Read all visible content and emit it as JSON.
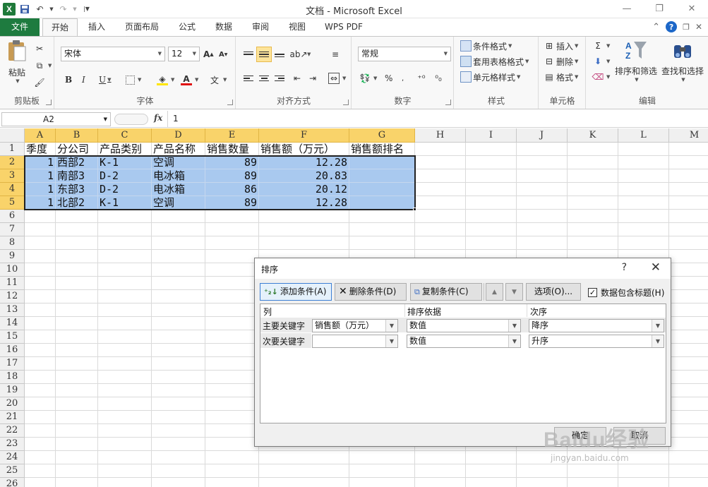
{
  "window": {
    "title": "文档 - Microsoft Excel"
  },
  "tabs": [
    {
      "label": "文件"
    },
    {
      "label": "开始"
    },
    {
      "label": "插入"
    },
    {
      "label": "页面布局"
    },
    {
      "label": "公式"
    },
    {
      "label": "数据"
    },
    {
      "label": "审阅"
    },
    {
      "label": "视图"
    },
    {
      "label": "WPS PDF"
    }
  ],
  "ribbon": {
    "clipboard": {
      "label": "剪贴板",
      "paste": "粘贴"
    },
    "font": {
      "label": "字体",
      "family": "宋体",
      "size": "12",
      "bold": "B",
      "italic": "I",
      "underline": "U"
    },
    "alignment": {
      "label": "对齐方式"
    },
    "number": {
      "label": "数字",
      "format": "常规",
      "percent": "%"
    },
    "styles": {
      "label": "样式",
      "conditional": "条件格式",
      "table_format": "套用表格格式",
      "cell_style": "单元格样式"
    },
    "cells": {
      "label": "单元格",
      "insert": "插入",
      "delete": "删除",
      "format": "格式"
    },
    "editing": {
      "label": "编辑",
      "sort_filter": "排序和筛选",
      "find_select": "查找和选择"
    }
  },
  "formula_bar": {
    "name_box": "A2",
    "fx": "fx",
    "value": "1"
  },
  "sheet": {
    "columns": [
      "A",
      "B",
      "C",
      "D",
      "E",
      "F",
      "G",
      "H",
      "I",
      "J",
      "K",
      "L",
      "M"
    ],
    "rows": [
      "1",
      "2",
      "3",
      "4",
      "5",
      "6",
      "7",
      "8",
      "9",
      "10",
      "11",
      "12",
      "13",
      "14",
      "15",
      "16",
      "17",
      "18",
      "19",
      "20",
      "21",
      "22",
      "23",
      "24",
      "25",
      "26"
    ],
    "header": [
      "季度",
      "分公司",
      "产品类别",
      "产品名称",
      "销售数量",
      "销售额（万元）",
      "销售额排名"
    ],
    "data": [
      [
        "1",
        "西部2",
        "K-1",
        "空调",
        "89",
        "12.28",
        ""
      ],
      [
        "1",
        "南部3",
        "D-2",
        "电冰箱",
        "89",
        "20.83",
        ""
      ],
      [
        "1",
        "东部3",
        "D-2",
        "电冰箱",
        "86",
        "20.12",
        ""
      ],
      [
        "1",
        "北部2",
        "K-1",
        "空调",
        "89",
        "12.28",
        ""
      ]
    ]
  },
  "dialog": {
    "title": "排序",
    "help": "?",
    "close": "✕",
    "add": "添加条件(A)",
    "delete": "删除条件(D)",
    "copy": "复制条件(C)",
    "options": "选项(O)...",
    "has_header": "数据包含标题(H)",
    "col_header": "列",
    "sort_on_header": "排序依据",
    "order_header": "次序",
    "rows": [
      {
        "label": "主要关键字",
        "column": "销售额（万元）",
        "sort_on": "数值",
        "order": "降序"
      },
      {
        "label": "次要关键字",
        "column": "",
        "sort_on": "数值",
        "order": "升序"
      }
    ],
    "ok": "确定",
    "cancel": "取消"
  },
  "watermark": {
    "brand": "Baidu经验",
    "url": "jingyan.baidu.com"
  },
  "colors": {
    "file_tab": "#1e7b3f",
    "selection": "#a9c9ef",
    "header_highlight": "#f9d36a"
  }
}
